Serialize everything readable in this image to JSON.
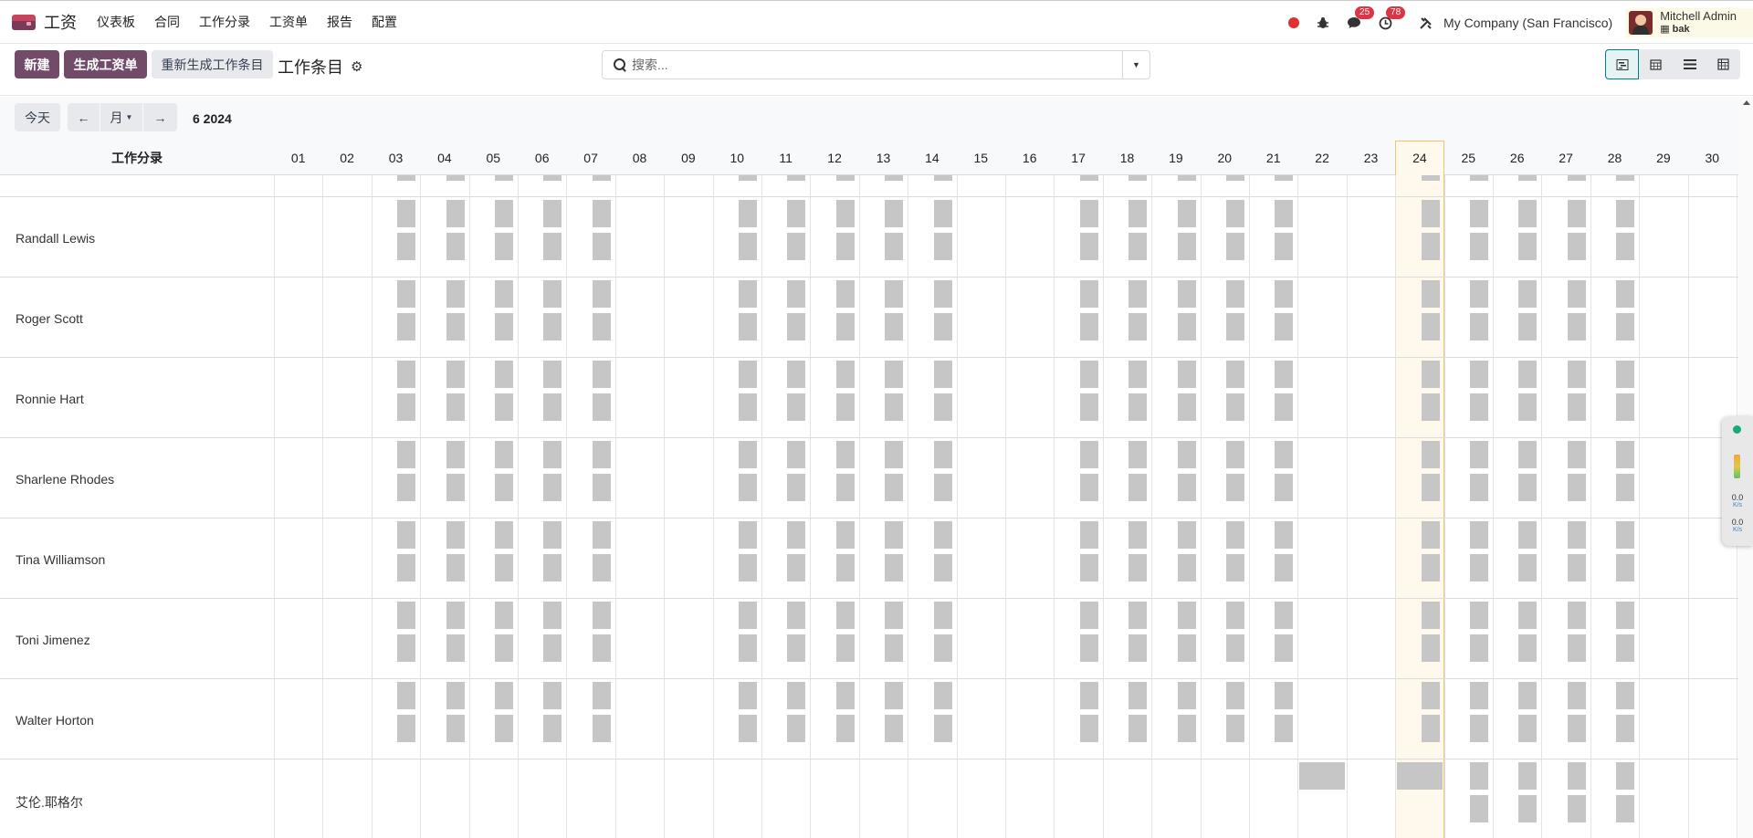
{
  "navbar": {
    "app_name": "工资",
    "menu": [
      "仪表板",
      "合同",
      "工作分录",
      "工资单",
      "报告",
      "配置"
    ],
    "messages_count": "25",
    "activities_count": "78",
    "company": "My Company (San Francisco)",
    "user_name": "Mitchell Admin",
    "user_db": "bak"
  },
  "control_panel": {
    "new_label": "新建",
    "generate_label": "生成工资单",
    "regenerate_label": "重新生成工作条目",
    "breadcrumb": "工作条目",
    "search_placeholder": "搜索...",
    "views": [
      "gantt-icon",
      "calendar-icon",
      "list-icon",
      "pivot-icon"
    ],
    "active_view": "gantt-icon"
  },
  "gantt_toolbar": {
    "today_label": "今天",
    "scale_label": "月",
    "period_label": "6 2024"
  },
  "gantt": {
    "group_header": "工作分录",
    "days": [
      "01",
      "02",
      "03",
      "04",
      "05",
      "06",
      "07",
      "08",
      "09",
      "10",
      "11",
      "12",
      "13",
      "14",
      "15",
      "16",
      "17",
      "18",
      "19",
      "20",
      "21",
      "22",
      "23",
      "24",
      "25",
      "26",
      "27",
      "28",
      "29",
      "30"
    ],
    "today": "24",
    "rows": [
      {
        "label": "Randall Lewis"
      },
      {
        "label": "Roger Scott"
      },
      {
        "label": "Ronnie Hart"
      },
      {
        "label": "Sharlene Rhodes"
      },
      {
        "label": "Tina Williamson"
      },
      {
        "label": "Toni Jimenez"
      },
      {
        "label": "Walter Horton"
      },
      {
        "label": "艾伦.耶格尔"
      }
    ],
    "colors": {
      "pill": "#c6c6c6",
      "today_bg": "#fef9ec",
      "primary": "#714b67"
    }
  },
  "widget": {
    "up_value": "0.0",
    "up_unit": "K/s",
    "down_value": "0.0",
    "down_unit": "K/s"
  }
}
